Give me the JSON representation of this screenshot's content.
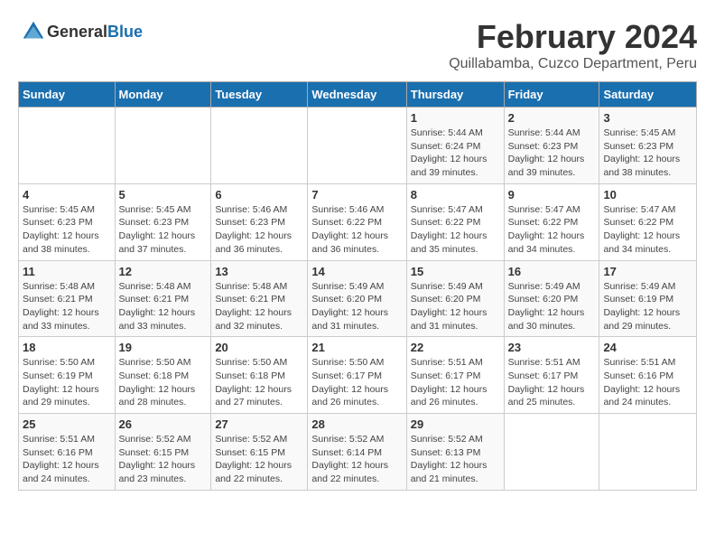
{
  "header": {
    "logo_general": "General",
    "logo_blue": "Blue",
    "title": "February 2024",
    "subtitle": "Quillabamba, Cuzco Department, Peru"
  },
  "days_of_week": [
    "Sunday",
    "Monday",
    "Tuesday",
    "Wednesday",
    "Thursday",
    "Friday",
    "Saturday"
  ],
  "weeks": [
    [
      {
        "day": "",
        "sunrise": "",
        "sunset": "",
        "daylight": ""
      },
      {
        "day": "",
        "sunrise": "",
        "sunset": "",
        "daylight": ""
      },
      {
        "day": "",
        "sunrise": "",
        "sunset": "",
        "daylight": ""
      },
      {
        "day": "",
        "sunrise": "",
        "sunset": "",
        "daylight": ""
      },
      {
        "day": "1",
        "sunrise": "Sunrise: 5:44 AM",
        "sunset": "Sunset: 6:24 PM",
        "daylight": "Daylight: 12 hours and 39 minutes."
      },
      {
        "day": "2",
        "sunrise": "Sunrise: 5:44 AM",
        "sunset": "Sunset: 6:23 PM",
        "daylight": "Daylight: 12 hours and 39 minutes."
      },
      {
        "day": "3",
        "sunrise": "Sunrise: 5:45 AM",
        "sunset": "Sunset: 6:23 PM",
        "daylight": "Daylight: 12 hours and 38 minutes."
      }
    ],
    [
      {
        "day": "4",
        "sunrise": "Sunrise: 5:45 AM",
        "sunset": "Sunset: 6:23 PM",
        "daylight": "Daylight: 12 hours and 38 minutes."
      },
      {
        "day": "5",
        "sunrise": "Sunrise: 5:45 AM",
        "sunset": "Sunset: 6:23 PM",
        "daylight": "Daylight: 12 hours and 37 minutes."
      },
      {
        "day": "6",
        "sunrise": "Sunrise: 5:46 AM",
        "sunset": "Sunset: 6:23 PM",
        "daylight": "Daylight: 12 hours and 36 minutes."
      },
      {
        "day": "7",
        "sunrise": "Sunrise: 5:46 AM",
        "sunset": "Sunset: 6:22 PM",
        "daylight": "Daylight: 12 hours and 36 minutes."
      },
      {
        "day": "8",
        "sunrise": "Sunrise: 5:47 AM",
        "sunset": "Sunset: 6:22 PM",
        "daylight": "Daylight: 12 hours and 35 minutes."
      },
      {
        "day": "9",
        "sunrise": "Sunrise: 5:47 AM",
        "sunset": "Sunset: 6:22 PM",
        "daylight": "Daylight: 12 hours and 34 minutes."
      },
      {
        "day": "10",
        "sunrise": "Sunrise: 5:47 AM",
        "sunset": "Sunset: 6:22 PM",
        "daylight": "Daylight: 12 hours and 34 minutes."
      }
    ],
    [
      {
        "day": "11",
        "sunrise": "Sunrise: 5:48 AM",
        "sunset": "Sunset: 6:21 PM",
        "daylight": "Daylight: 12 hours and 33 minutes."
      },
      {
        "day": "12",
        "sunrise": "Sunrise: 5:48 AM",
        "sunset": "Sunset: 6:21 PM",
        "daylight": "Daylight: 12 hours and 33 minutes."
      },
      {
        "day": "13",
        "sunrise": "Sunrise: 5:48 AM",
        "sunset": "Sunset: 6:21 PM",
        "daylight": "Daylight: 12 hours and 32 minutes."
      },
      {
        "day": "14",
        "sunrise": "Sunrise: 5:49 AM",
        "sunset": "Sunset: 6:20 PM",
        "daylight": "Daylight: 12 hours and 31 minutes."
      },
      {
        "day": "15",
        "sunrise": "Sunrise: 5:49 AM",
        "sunset": "Sunset: 6:20 PM",
        "daylight": "Daylight: 12 hours and 31 minutes."
      },
      {
        "day": "16",
        "sunrise": "Sunrise: 5:49 AM",
        "sunset": "Sunset: 6:20 PM",
        "daylight": "Daylight: 12 hours and 30 minutes."
      },
      {
        "day": "17",
        "sunrise": "Sunrise: 5:49 AM",
        "sunset": "Sunset: 6:19 PM",
        "daylight": "Daylight: 12 hours and 29 minutes."
      }
    ],
    [
      {
        "day": "18",
        "sunrise": "Sunrise: 5:50 AM",
        "sunset": "Sunset: 6:19 PM",
        "daylight": "Daylight: 12 hours and 29 minutes."
      },
      {
        "day": "19",
        "sunrise": "Sunrise: 5:50 AM",
        "sunset": "Sunset: 6:18 PM",
        "daylight": "Daylight: 12 hours and 28 minutes."
      },
      {
        "day": "20",
        "sunrise": "Sunrise: 5:50 AM",
        "sunset": "Sunset: 6:18 PM",
        "daylight": "Daylight: 12 hours and 27 minutes."
      },
      {
        "day": "21",
        "sunrise": "Sunrise: 5:50 AM",
        "sunset": "Sunset: 6:17 PM",
        "daylight": "Daylight: 12 hours and 26 minutes."
      },
      {
        "day": "22",
        "sunrise": "Sunrise: 5:51 AM",
        "sunset": "Sunset: 6:17 PM",
        "daylight": "Daylight: 12 hours and 26 minutes."
      },
      {
        "day": "23",
        "sunrise": "Sunrise: 5:51 AM",
        "sunset": "Sunset: 6:17 PM",
        "daylight": "Daylight: 12 hours and 25 minutes."
      },
      {
        "day": "24",
        "sunrise": "Sunrise: 5:51 AM",
        "sunset": "Sunset: 6:16 PM",
        "daylight": "Daylight: 12 hours and 24 minutes."
      }
    ],
    [
      {
        "day": "25",
        "sunrise": "Sunrise: 5:51 AM",
        "sunset": "Sunset: 6:16 PM",
        "daylight": "Daylight: 12 hours and 24 minutes."
      },
      {
        "day": "26",
        "sunrise": "Sunrise: 5:52 AM",
        "sunset": "Sunset: 6:15 PM",
        "daylight": "Daylight: 12 hours and 23 minutes."
      },
      {
        "day": "27",
        "sunrise": "Sunrise: 5:52 AM",
        "sunset": "Sunset: 6:15 PM",
        "daylight": "Daylight: 12 hours and 22 minutes."
      },
      {
        "day": "28",
        "sunrise": "Sunrise: 5:52 AM",
        "sunset": "Sunset: 6:14 PM",
        "daylight": "Daylight: 12 hours and 22 minutes."
      },
      {
        "day": "29",
        "sunrise": "Sunrise: 5:52 AM",
        "sunset": "Sunset: 6:13 PM",
        "daylight": "Daylight: 12 hours and 21 minutes."
      },
      {
        "day": "",
        "sunrise": "",
        "sunset": "",
        "daylight": ""
      },
      {
        "day": "",
        "sunrise": "",
        "sunset": "",
        "daylight": ""
      }
    ]
  ]
}
